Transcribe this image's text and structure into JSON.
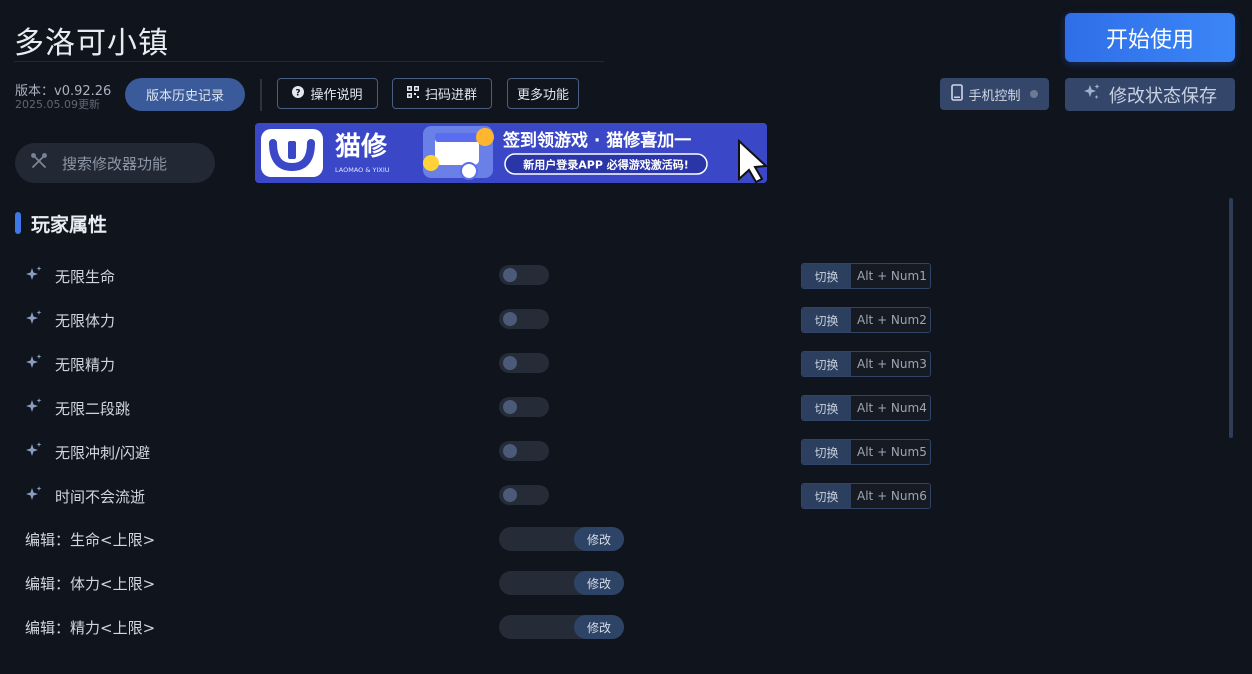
{
  "app": {
    "title": "多洛可小镇",
    "start_label": "开始使用"
  },
  "version": {
    "text": "版本：v0.92.26",
    "date": "2025.05.09更新",
    "history_label": "版本历史记录"
  },
  "toolbar": {
    "help_label": "操作说明",
    "qr_label": "扫码进群",
    "more_label": "更多功能",
    "phone_label": "手机控制",
    "save_label": "修改状态保存"
  },
  "search": {
    "placeholder": "搜索修改器功能"
  },
  "banner": {
    "brand": "猫修",
    "brand_sub": "LAOMAO & YIXIU",
    "headline": "签到领游戏 · 猫修喜加一",
    "subline": "新用户登录APP  必得游戏激活码!"
  },
  "section": {
    "title": "玩家属性"
  },
  "toggles": [
    {
      "label": "无限生命",
      "key_action": "切换",
      "hotkey": "Alt + Num1"
    },
    {
      "label": "无限体力",
      "key_action": "切换",
      "hotkey": "Alt + Num2"
    },
    {
      "label": "无限精力",
      "key_action": "切换",
      "hotkey": "Alt + Num3"
    },
    {
      "label": "无限二段跳",
      "key_action": "切换",
      "hotkey": "Alt + Num4"
    },
    {
      "label": "无限冲刺/闪避",
      "key_action": "切换",
      "hotkey": "Alt + Num5"
    },
    {
      "label": "时间不会流逝",
      "key_action": "切换",
      "hotkey": "Alt + Num6"
    }
  ],
  "edits": [
    {
      "label": "编辑：生命<上限>",
      "button": "修改"
    },
    {
      "label": "编辑：体力<上限>",
      "button": "修改"
    },
    {
      "label": "编辑：精力<上限>",
      "button": "修改"
    }
  ],
  "colors": {
    "accent": "#3d78e6",
    "background": "#0f141d",
    "button_dark": "#34476a"
  },
  "icons": {
    "search": "wrench-icon",
    "feature": "sparkle-icon",
    "help": "question-icon",
    "qr": "qr-icon",
    "phone": "phone-icon",
    "save": "sparkle-icon"
  }
}
